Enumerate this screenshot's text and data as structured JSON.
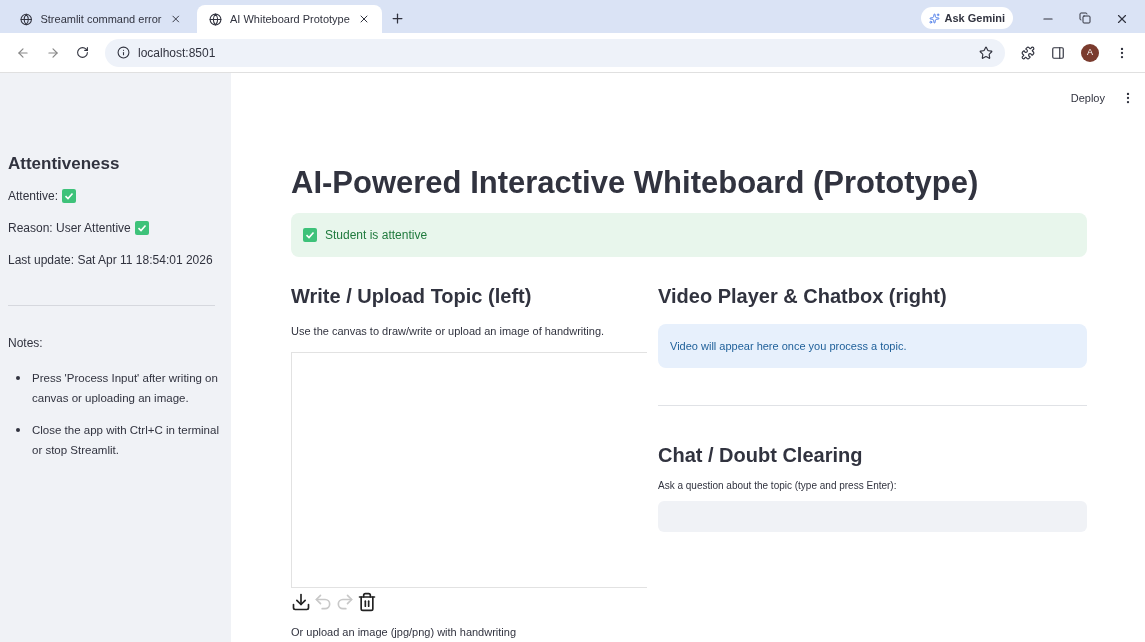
{
  "browser": {
    "tabs": [
      {
        "title": "Streamlit command error",
        "selected": false
      },
      {
        "title": "AI Whiteboard Prototype",
        "selected": true
      }
    ],
    "gemini": "Ask Gemini",
    "address": "localhost:8501",
    "profile": "A"
  },
  "header": {
    "deploy": "Deploy"
  },
  "sidebar": {
    "title": "Attentiveness",
    "status": [
      {
        "label": "Attentive:",
        "checked": true
      },
      {
        "label": "Reason: User Attentive",
        "checked": true
      }
    ],
    "last_update": "Last update: Sat Apr 11 18:54:01 2026",
    "notes_label": "Notes:",
    "notes": [
      "Press 'Process Input' after writing on canvas or uploading an image.",
      "Close the app with Ctrl+C in terminal or stop Streamlit."
    ]
  },
  "title": "AI-Powered Interactive Whiteboard (Prototype)",
  "alert": {
    "text": "Student is attentive",
    "checked": true
  },
  "left": {
    "heading": "Write / Upload Topic (left)",
    "caption": "Use the canvas to draw/write or upload an image of handwriting.",
    "tools": [
      {
        "kind": "download",
        "disabled": false
      },
      {
        "kind": "undo",
        "disabled": true
      },
      {
        "kind": "redo",
        "disabled": true
      },
      {
        "kind": "delete",
        "disabled": false
      }
    ],
    "upload_label": "Or upload an image (jpg/png) with handwriting"
  },
  "right": {
    "heading": "Video Player & Chatbox (right)",
    "info": "Video will appear here once you process a topic.",
    "chat_heading": "Chat / Doubt Clearing",
    "chat_label": "Ask a question about the topic (type and press Enter):"
  }
}
